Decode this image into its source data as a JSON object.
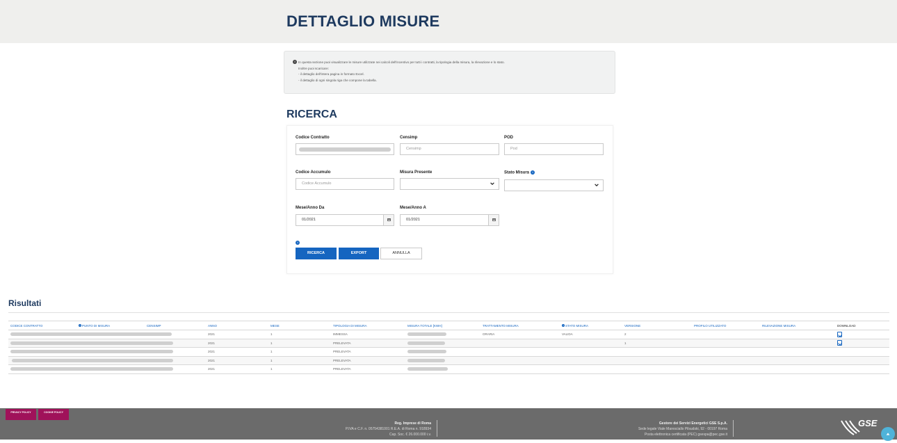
{
  "page": {
    "title": "DETTAGLIO MISURE"
  },
  "info": {
    "lines": [
      "In questa sezione puoi visualizzare le misure utilizzate nei calcoli dell'incentivo per tutti i contratti, la tipologia della misura, la rilevazione e lo stato.",
      "Inoltre puoi scaricare:",
      "- il dettaglio dell'intera pagina in formato Excel.",
      "- il dettaglio di ogni singola riga che compone la tabella."
    ]
  },
  "search": {
    "title": "RICERCA",
    "codice_contratto": {
      "label": "Codice Contratto",
      "value": ""
    },
    "censimp": {
      "label": "Censimp",
      "placeholder": "Censimp"
    },
    "pod": {
      "label": "POD",
      "placeholder": "Pod"
    },
    "codice_accumulo": {
      "label": "Codice Accumulo",
      "placeholder": "Codice Accumulo"
    },
    "misura_presente": {
      "label": "Misura Presente",
      "value": ""
    },
    "stato_misura": {
      "label": "Stato Misura",
      "value": ""
    },
    "mese_anno_da": {
      "label": "Mese/Anno Da",
      "value": "01/2021"
    },
    "mese_anno_a": {
      "label": "Mese/Anno A",
      "value": "01/2021"
    },
    "buttons": {
      "ricerca": "RICERCA",
      "export": "EXPORT",
      "annulla": "ANNULLA"
    }
  },
  "results": {
    "title": "Risultati",
    "columns": [
      "CODICE CONTRATTO",
      "PUNTO DI MISURA",
      "CENSIMP",
      "ANNO",
      "MESE",
      "TIPOLOGIA DI MISURA",
      "MISURA TOTALE [KWH]",
      "TRATTAMENTO MISURA",
      "STATO MISURA",
      "VERSIONE",
      "PROFILO UTILIZZATO",
      "RILEVAZIONE MISURA",
      "DOWNLOAD"
    ],
    "rows": [
      {
        "anno": "2021",
        "mese": "1",
        "tipologia": "IMMESSA",
        "trattamento": "ORARIA",
        "stato": "VALIDA",
        "versione": "2",
        "download": true
      },
      {
        "anno": "2021",
        "mese": "1",
        "tipologia": "PRELEVATA",
        "trattamento": "",
        "stato": "",
        "versione": "1",
        "download": true
      },
      {
        "anno": "2021",
        "mese": "1",
        "tipologia": "PRELEVATA",
        "trattamento": "",
        "stato": "",
        "versione": "",
        "download": false
      },
      {
        "anno": "2021",
        "mese": "1",
        "tipologia": "PRELEVATA",
        "trattamento": "",
        "stato": "",
        "versione": "",
        "download": false
      },
      {
        "anno": "2021",
        "mese": "1",
        "tipologia": "PRELEVATA",
        "trattamento": "",
        "stato": "",
        "versione": "",
        "download": false
      }
    ]
  },
  "footer": {
    "privacy": "PRIVACY POLICY",
    "cookie": "COOKIE POLICY",
    "reg_title": "Reg. Imprese di Roma",
    "reg_line1": "P.IVA e C.F. n. 05754381001 R.E.A. di Roma n. 918934",
    "reg_line2": "Cap. Soc. € 26.000.000 i.v.",
    "gse_title": "Gestore dei Servizi Energetici GSE S.p.A.",
    "gse_line1": "Sede legale Viale Maresciallo Pilsudski, 92 - 00197 Roma",
    "gse_line2": "Posta elettronica certificata (PEC) gsespa@pec.gse.it",
    "logo_text": "GSE"
  },
  "colors": {
    "brand": "#1e3a5f",
    "accent": "#1565c0",
    "policy": "#a0125a",
    "footer": "#6b6b6b"
  }
}
